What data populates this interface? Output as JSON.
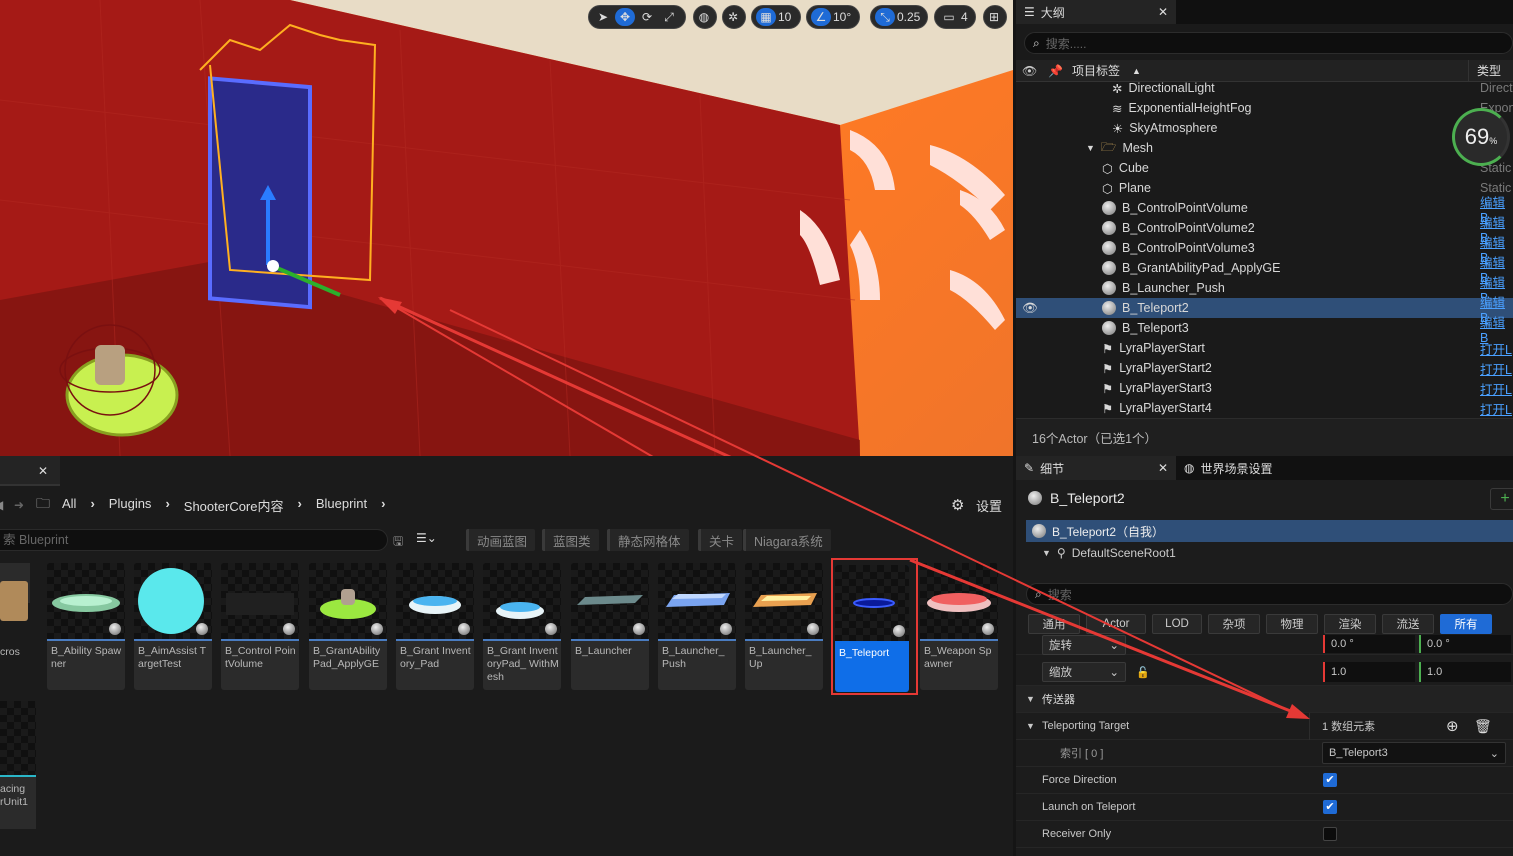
{
  "viewport": {
    "snap_grid": "10",
    "snap_rotation": "10°",
    "snap_scale": "0.25",
    "camera_speed": "4"
  },
  "outliner": {
    "tab_title": "大纲",
    "search_placeholder": "搜索.....",
    "col_label": "项目标签",
    "col_type": "类型",
    "perf_value": "69",
    "perf_unit": "%",
    "items": [
      {
        "label": "DirectionalLight",
        "type": "Direct",
        "icon": "light-icon"
      },
      {
        "label": "ExponentialHeightFog",
        "type": "Expon",
        "icon": "fog-icon"
      },
      {
        "label": "SkyAtmosphere",
        "type": "",
        "icon": "sky-icon"
      },
      {
        "label": "Mesh",
        "type": "",
        "icon": "folder-icon"
      },
      {
        "label": "Cube",
        "type": "Static",
        "icon": "mesh-icon"
      },
      {
        "label": "Plane",
        "type": "Static",
        "icon": "mesh-icon"
      },
      {
        "label": "B_ControlPointVolume",
        "type": "编辑B",
        "icon": "actor-icon"
      },
      {
        "label": "B_ControlPointVolume2",
        "type": "编辑B",
        "icon": "actor-icon"
      },
      {
        "label": "B_ControlPointVolume3",
        "type": "编辑B",
        "icon": "actor-icon"
      },
      {
        "label": "B_GrantAbilityPad_ApplyGE",
        "type": "编辑B",
        "icon": "actor-icon"
      },
      {
        "label": "B_Launcher_Push",
        "type": "编辑B",
        "icon": "actor-icon"
      },
      {
        "label": "B_Teleport2",
        "type": "编辑B",
        "icon": "actor-icon"
      },
      {
        "label": "B_Teleport3",
        "type": "编辑B",
        "icon": "actor-icon"
      },
      {
        "label": "LyraPlayerStart",
        "type": "打开L",
        "icon": "player-start-icon"
      },
      {
        "label": "LyraPlayerStart2",
        "type": "打开L",
        "icon": "player-start-icon"
      },
      {
        "label": "LyraPlayerStart3",
        "type": "打开L",
        "icon": "player-start-icon"
      },
      {
        "label": "LyraPlayerStart4",
        "type": "打开L",
        "icon": "player-start-icon"
      }
    ],
    "status": "16个Actor（已选1个）"
  },
  "details": {
    "tab_title": "细节",
    "world_tab": "世界场景设置",
    "actor_name": "B_Teleport2",
    "self_label": "B_Teleport2（自我）",
    "root_component": "DefaultSceneRoot1",
    "search_placeholder": "搜索",
    "filters": [
      "通用",
      "Actor",
      "LOD",
      "杂项",
      "物理",
      "渲染",
      "流送",
      "所有"
    ],
    "rotation_label": "旋转",
    "rotation_values": [
      "0.0 °",
      "0.0 °"
    ],
    "scale_label": "缩放",
    "scale_values": [
      "1.0",
      "1.0"
    ],
    "section_title": "传送器",
    "teleport_target_label": "Teleporting Target",
    "teleport_target_count": "1 数组元素",
    "index_label": "索引 [ 0 ]",
    "index_value": "B_Teleport3",
    "force_direction_label": "Force Direction",
    "force_direction": true,
    "launch_label": "Launch on Teleport",
    "launch_on_teleport": true,
    "receiver_label": "Receiver Only",
    "receiver_only": false
  },
  "content_browser": {
    "breadcrumb": [
      "All",
      "Plugins",
      "ShooterCore内容",
      "Blueprint"
    ],
    "settings_label": "设置",
    "search_placeholder": "索 Blueprint",
    "filter_chips": [
      "动画蓝图",
      "蓝图类",
      "静态网格体",
      "关卡",
      "Niagara系统"
    ],
    "assets": [
      {
        "name": "B_Ability Spawner"
      },
      {
        "name": "B_AimAssist TargetTest"
      },
      {
        "name": "B_Control PointVolume"
      },
      {
        "name": "B_GrantAbility Pad_ApplyGE"
      },
      {
        "name": "B_Grant Inventory_Pad"
      },
      {
        "name": "B_Grant InventoryPad_ WithMesh"
      },
      {
        "name": "B_Launcher"
      },
      {
        "name": "B_Launcher_ Push"
      },
      {
        "name": "B_Launcher_ Up"
      },
      {
        "name": "B_Teleport"
      },
      {
        "name": "B_Weapon Spawner"
      }
    ],
    "partial_left_top": "cros",
    "partial_left_bottom_1": "acing",
    "partial_left_bottom_2": "rUnit1"
  },
  "colors": {
    "accent_blue": "#1f6bd6",
    "highlight_red": "#e53935",
    "selected_row": "#2f4f78"
  }
}
